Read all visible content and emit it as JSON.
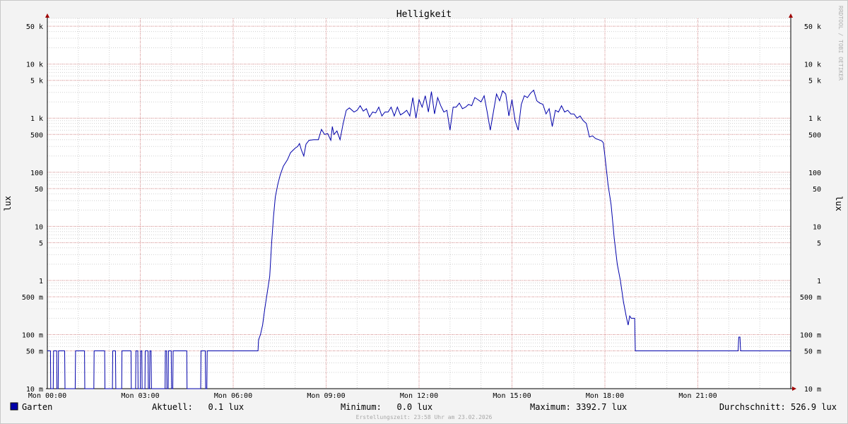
{
  "chart_data": {
    "type": "line",
    "title": "Helligkeit",
    "ylabel_left": "lux",
    "ylabel_right": "lux",
    "y_scale": "log",
    "ylim": [
      0.01,
      70000
    ],
    "y_ticks": [
      {
        "value": 0.01,
        "label": "10 m"
      },
      {
        "value": 0.05,
        "label": "50 m"
      },
      {
        "value": 0.1,
        "label": "100 m"
      },
      {
        "value": 0.5,
        "label": "500 m"
      },
      {
        "value": 1,
        "label": "1"
      },
      {
        "value": 5,
        "label": "5"
      },
      {
        "value": 10,
        "label": "10"
      },
      {
        "value": 50,
        "label": "50"
      },
      {
        "value": 100,
        "label": "100"
      },
      {
        "value": 500,
        "label": "500"
      },
      {
        "value": 1000,
        "label": "1 k"
      },
      {
        "value": 5000,
        "label": "5 k"
      },
      {
        "value": 10000,
        "label": "10 k"
      },
      {
        "value": 50000,
        "label": "50 k"
      }
    ],
    "x_unit": "hours",
    "xlim": [
      0,
      24
    ],
    "x_ticks": [
      {
        "value": 0,
        "label": "Mon 00:00"
      },
      {
        "value": 3,
        "label": "Mon 03:00"
      },
      {
        "value": 6,
        "label": "Mon 06:00"
      },
      {
        "value": 9,
        "label": "Mon 09:00"
      },
      {
        "value": 12,
        "label": "Mon 12:00"
      },
      {
        "value": 15,
        "label": "Mon 15:00"
      },
      {
        "value": 18,
        "label": "Mon 18:00"
      },
      {
        "value": 21,
        "label": "Mon 21:00"
      }
    ],
    "grid": true,
    "series": [
      {
        "name": "Garten",
        "color": "#0000aa",
        "points": [
          [
            0.0,
            0.05
          ],
          [
            0.1,
            0.05
          ],
          [
            0.11,
            0.01
          ],
          [
            0.19,
            0.01
          ],
          [
            0.2,
            0.05
          ],
          [
            0.3,
            0.05
          ],
          [
            0.31,
            0.01
          ],
          [
            0.35,
            0.01
          ],
          [
            0.36,
            0.05
          ],
          [
            0.56,
            0.05
          ],
          [
            0.57,
            0.01
          ],
          [
            0.9,
            0.01
          ],
          [
            0.91,
            0.05
          ],
          [
            1.2,
            0.05
          ],
          [
            1.21,
            0.01
          ],
          [
            1.5,
            0.01
          ],
          [
            1.51,
            0.05
          ],
          [
            1.85,
            0.05
          ],
          [
            1.86,
            0.01
          ],
          [
            2.1,
            0.01
          ],
          [
            2.11,
            0.05
          ],
          [
            2.2,
            0.05
          ],
          [
            2.21,
            0.01
          ],
          [
            2.4,
            0.01
          ],
          [
            2.41,
            0.05
          ],
          [
            2.7,
            0.05
          ],
          [
            2.71,
            0.01
          ],
          [
            2.85,
            0.01
          ],
          [
            2.86,
            0.05
          ],
          [
            2.92,
            0.05
          ],
          [
            2.93,
            0.01
          ],
          [
            3.0,
            0.01
          ],
          [
            3.01,
            0.05
          ],
          [
            3.05,
            0.05
          ],
          [
            3.06,
            0.01
          ],
          [
            3.15,
            0.01
          ],
          [
            3.16,
            0.05
          ],
          [
            3.25,
            0.05
          ],
          [
            3.26,
            0.01
          ],
          [
            3.3,
            0.01
          ],
          [
            3.31,
            0.05
          ],
          [
            3.35,
            0.05
          ],
          [
            3.36,
            0.01
          ],
          [
            3.8,
            0.01
          ],
          [
            3.81,
            0.05
          ],
          [
            3.85,
            0.05
          ],
          [
            3.86,
            0.01
          ],
          [
            3.9,
            0.01
          ],
          [
            3.91,
            0.05
          ],
          [
            4.0,
            0.05
          ],
          [
            4.01,
            0.01
          ],
          [
            4.05,
            0.01
          ],
          [
            4.06,
            0.05
          ],
          [
            4.5,
            0.05
          ],
          [
            4.51,
            0.01
          ],
          [
            4.95,
            0.01
          ],
          [
            4.96,
            0.05
          ],
          [
            5.1,
            0.05
          ],
          [
            5.11,
            0.01
          ],
          [
            5.15,
            0.01
          ],
          [
            5.16,
            0.05
          ],
          [
            6.8,
            0.05
          ],
          [
            6.82,
            0.08
          ],
          [
            6.88,
            0.1
          ],
          [
            6.95,
            0.15
          ],
          [
            7.02,
            0.3
          ],
          [
            7.1,
            0.6
          ],
          [
            7.18,
            1.2
          ],
          [
            7.24,
            5
          ],
          [
            7.3,
            15
          ],
          [
            7.36,
            35
          ],
          [
            7.44,
            60
          ],
          [
            7.52,
            90
          ],
          [
            7.62,
            130
          ],
          [
            7.75,
            170
          ],
          [
            7.85,
            230
          ],
          [
            8.0,
            280
          ],
          [
            8.08,
            300
          ],
          [
            8.14,
            340
          ],
          [
            8.2,
            260
          ],
          [
            8.28,
            200
          ],
          [
            8.35,
            330
          ],
          [
            8.45,
            390
          ],
          [
            8.6,
            400
          ],
          [
            8.75,
            400
          ],
          [
            8.85,
            620
          ],
          [
            8.95,
            500
          ],
          [
            9.05,
            520
          ],
          [
            9.15,
            390
          ],
          [
            9.2,
            700
          ],
          [
            9.25,
            500
          ],
          [
            9.35,
            580
          ],
          [
            9.45,
            400
          ],
          [
            9.55,
            800
          ],
          [
            9.65,
            1400
          ],
          [
            9.75,
            1550
          ],
          [
            9.9,
            1300
          ],
          [
            10.0,
            1400
          ],
          [
            10.1,
            1700
          ],
          [
            10.2,
            1350
          ],
          [
            10.3,
            1500
          ],
          [
            10.4,
            1050
          ],
          [
            10.5,
            1300
          ],
          [
            10.6,
            1250
          ],
          [
            10.7,
            1600
          ],
          [
            10.8,
            1100
          ],
          [
            10.9,
            1300
          ],
          [
            11.0,
            1300
          ],
          [
            11.1,
            1600
          ],
          [
            11.2,
            1100
          ],
          [
            11.3,
            1600
          ],
          [
            11.4,
            1150
          ],
          [
            11.5,
            1250
          ],
          [
            11.6,
            1400
          ],
          [
            11.7,
            1100
          ],
          [
            11.8,
            2400
          ],
          [
            11.9,
            1000
          ],
          [
            12.0,
            2200
          ],
          [
            12.1,
            1600
          ],
          [
            12.2,
            2600
          ],
          [
            12.3,
            1300
          ],
          [
            12.4,
            3100
          ],
          [
            12.5,
            1200
          ],
          [
            12.6,
            2400
          ],
          [
            12.7,
            1700
          ],
          [
            12.8,
            1300
          ],
          [
            12.9,
            1400
          ],
          [
            13.0,
            600
          ],
          [
            13.1,
            1600
          ],
          [
            13.2,
            1600
          ],
          [
            13.3,
            1900
          ],
          [
            13.4,
            1500
          ],
          [
            13.5,
            1600
          ],
          [
            13.6,
            1800
          ],
          [
            13.7,
            1700
          ],
          [
            13.8,
            2400
          ],
          [
            13.9,
            2200
          ],
          [
            14.0,
            2000
          ],
          [
            14.1,
            2600
          ],
          [
            14.2,
            1300
          ],
          [
            14.3,
            600
          ],
          [
            14.4,
            1300
          ],
          [
            14.5,
            2800
          ],
          [
            14.6,
            2100
          ],
          [
            14.7,
            3200
          ],
          [
            14.8,
            2800
          ],
          [
            14.9,
            1100
          ],
          [
            15.0,
            2200
          ],
          [
            15.1,
            900
          ],
          [
            15.2,
            600
          ],
          [
            15.3,
            1800
          ],
          [
            15.4,
            2600
          ],
          [
            15.5,
            2400
          ],
          [
            15.6,
            2900
          ],
          [
            15.7,
            3300
          ],
          [
            15.8,
            2100
          ],
          [
            15.9,
            1900
          ],
          [
            16.0,
            1800
          ],
          [
            16.1,
            1200
          ],
          [
            16.2,
            1500
          ],
          [
            16.3,
            700
          ],
          [
            16.4,
            1400
          ],
          [
            16.5,
            1300
          ],
          [
            16.6,
            1700
          ],
          [
            16.7,
            1300
          ],
          [
            16.8,
            1400
          ],
          [
            16.9,
            1200
          ],
          [
            17.0,
            1200
          ],
          [
            17.1,
            1000
          ],
          [
            17.2,
            1100
          ],
          [
            17.3,
            900
          ],
          [
            17.4,
            800
          ],
          [
            17.5,
            450
          ],
          [
            17.6,
            470
          ],
          [
            17.7,
            420
          ],
          [
            17.8,
            400
          ],
          [
            17.9,
            380
          ],
          [
            17.95,
            350
          ],
          [
            18.0,
            200
          ],
          [
            18.1,
            60
          ],
          [
            18.2,
            25
          ],
          [
            18.3,
            6
          ],
          [
            18.4,
            2
          ],
          [
            18.5,
            1
          ],
          [
            18.6,
            0.4
          ],
          [
            18.7,
            0.2
          ],
          [
            18.75,
            0.15
          ],
          [
            18.8,
            0.22
          ],
          [
            18.85,
            0.2
          ],
          [
            18.9,
            0.2
          ],
          [
            18.96,
            0.2
          ],
          [
            18.98,
            0.05
          ],
          [
            22.3,
            0.05
          ],
          [
            22.32,
            0.09
          ],
          [
            22.36,
            0.09
          ],
          [
            22.38,
            0.05
          ],
          [
            24.0,
            0.05
          ]
        ]
      }
    ]
  },
  "legend": {
    "series_label": "Garten",
    "swatch_color": "#0000aa",
    "current": "Aktuell:   0.1 lux",
    "minimum": "Minimum:   0.0 lux",
    "maximum": "Maximum: 3392.7 lux",
    "average": "Durchschnitt: 526.9 lux"
  },
  "footer": "Erstellungszeit: 23:58 Uhr am 23.02.2026",
  "watermark": "RRDTOOL / TOBI OETIKER",
  "colors": {
    "line": "#0000aa",
    "minor_grid": "#d0d0d0",
    "major_grid": "#e8a0a0",
    "axis_arrow": "#a00000"
  }
}
